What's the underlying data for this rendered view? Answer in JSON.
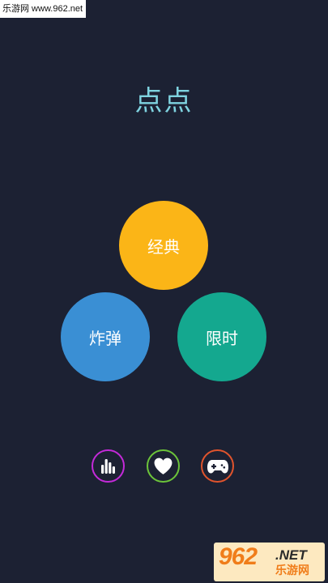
{
  "watermark_top": "乐游网 www.962.net",
  "title": "点点",
  "modes": {
    "classic": "经典",
    "bomb": "炸弹",
    "timed": "限时"
  },
  "icons": {
    "rank": "bar-chart-icon",
    "like": "heart-icon",
    "games": "gamepad-icon"
  },
  "colors": {
    "background": "#1c2133",
    "title": "#7fd3e0",
    "classic": "#fbb517",
    "bomb": "#3a8fd4",
    "timed": "#14a88f",
    "rank_ring": "#c42ad9",
    "like_ring": "#6cc43a",
    "games_ring": "#e0542d"
  },
  "watermark_bottom": {
    "number": "962",
    "domain": ".NET",
    "brand": "乐游网"
  }
}
